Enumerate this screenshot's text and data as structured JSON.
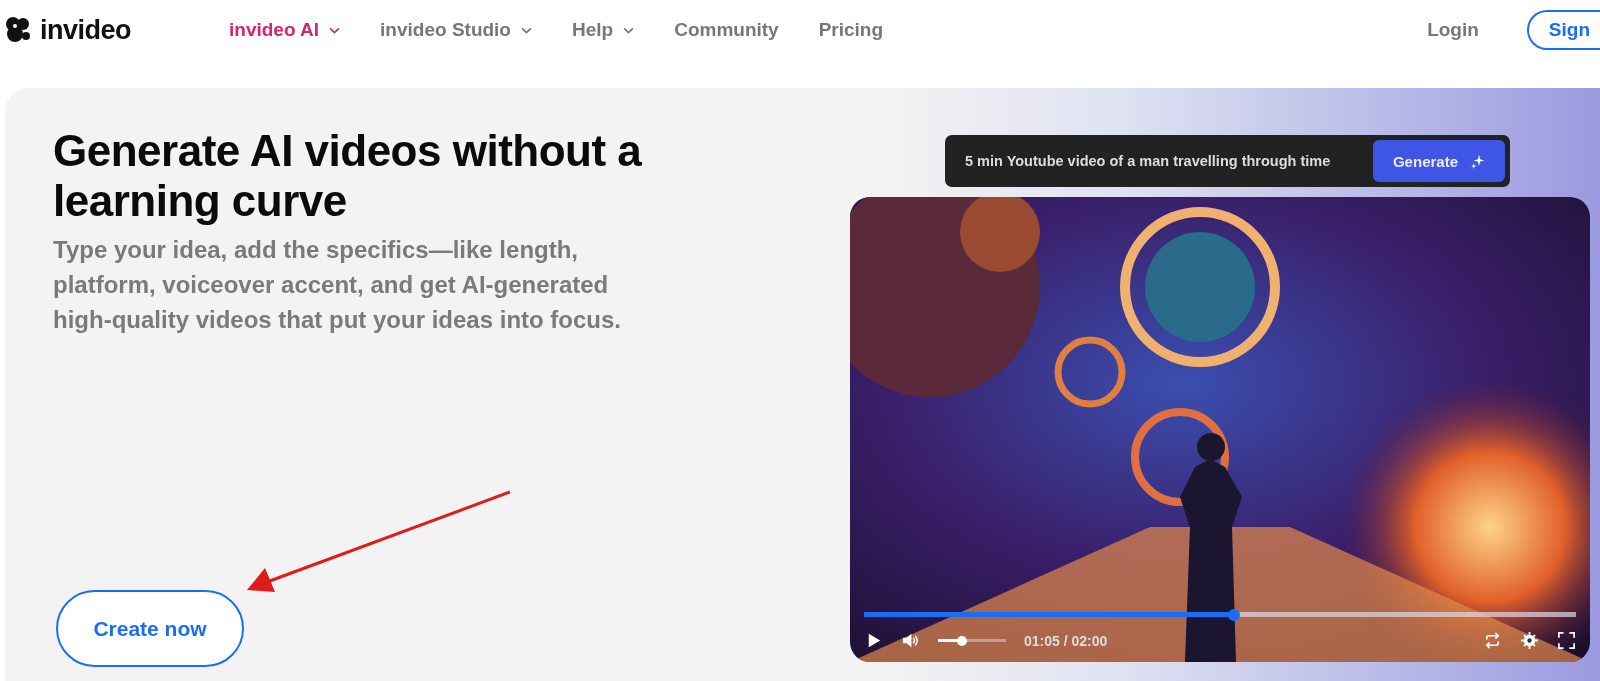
{
  "brand": {
    "name": "invideo"
  },
  "nav": {
    "items": [
      {
        "label": "invideo AI",
        "has_menu": true,
        "selected": true
      },
      {
        "label": "invideo Studio",
        "has_menu": true,
        "selected": false
      },
      {
        "label": "Help",
        "has_menu": true,
        "selected": false
      },
      {
        "label": "Community",
        "has_menu": false,
        "selected": false
      },
      {
        "label": "Pricing",
        "has_menu": false,
        "selected": false
      }
    ],
    "login": "Login",
    "signup": "Sign"
  },
  "hero": {
    "title": "Generate AI videos without a learning curve",
    "subtitle": "Type your idea, add the specifics—like length, platform, voiceover accent, and get AI-generated high-quality videos that put your ideas into focus.",
    "cta": "Create now"
  },
  "prompt": {
    "value": "5 min Youtube video of a man travelling through time",
    "button": "Generate"
  },
  "player": {
    "progress": {
      "level": 0.52
    },
    "volume": {
      "level": 0.35
    },
    "time": "01:05 / 02:00"
  }
}
